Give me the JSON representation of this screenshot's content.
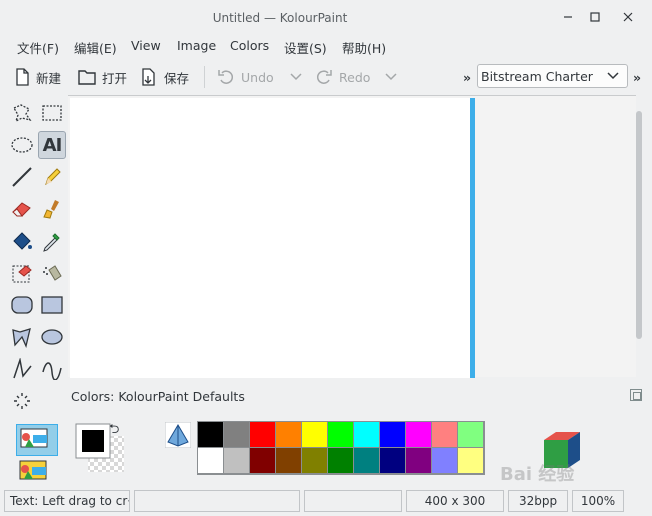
{
  "window": {
    "title": "Untitled  — KolourPaint",
    "minimize_icon": "minimize-icon",
    "maximize_icon": "maximize-icon",
    "close_icon": "close-icon"
  },
  "menu": [
    "文件(F)",
    "编辑(E)",
    "View",
    "Image",
    "Colors",
    "设置(S)",
    "帮助(H)"
  ],
  "toolbar": {
    "new_label": "新建",
    "open_label": "打开",
    "save_label": "保存",
    "undo_label": "Undo",
    "redo_label": "Redo",
    "overflow": "»",
    "font_overflow": "»",
    "font_value": "Bitstream Charter"
  },
  "tools": [
    "free-form-selection",
    "rectangular-selection",
    "elliptical-selection",
    "text",
    "line",
    "pen",
    "eraser",
    "brush",
    "flood-fill",
    "color-picker",
    "color-eraser",
    "spraycan",
    "rounded-rectangle",
    "rectangle",
    "polygon",
    "ellipse",
    "connected-lines",
    "curve",
    "zoom"
  ],
  "text_tool_label": "AI",
  "colors": {
    "header_prefix": "Colors: ",
    "header_name": "KolourPaint Defaults",
    "foreground": "#000000",
    "background": "#ffffff",
    "swap": "⮌",
    "row1": [
      "#000000",
      "#808080",
      "#ff0000",
      "#ff8000",
      "#ffff00",
      "#00ff00",
      "#00ffff",
      "#0000ff",
      "#ff00ff",
      "#ff8080",
      "#80ff80"
    ],
    "row2": [
      "#ffffff",
      "#c0c0c0",
      "#800000",
      "#804000",
      "#808000",
      "#008000",
      "#008080",
      "#000080",
      "#800080",
      "#8080ff",
      "#ffff80"
    ]
  },
  "accent": "#3daee9",
  "status": {
    "message": "Text: Left drag to cr···",
    "field2": "",
    "field3": "",
    "size": "400 x 300",
    "bpp": "32bpp",
    "zoom": "100%"
  },
  "watermark": "Bai 经验"
}
